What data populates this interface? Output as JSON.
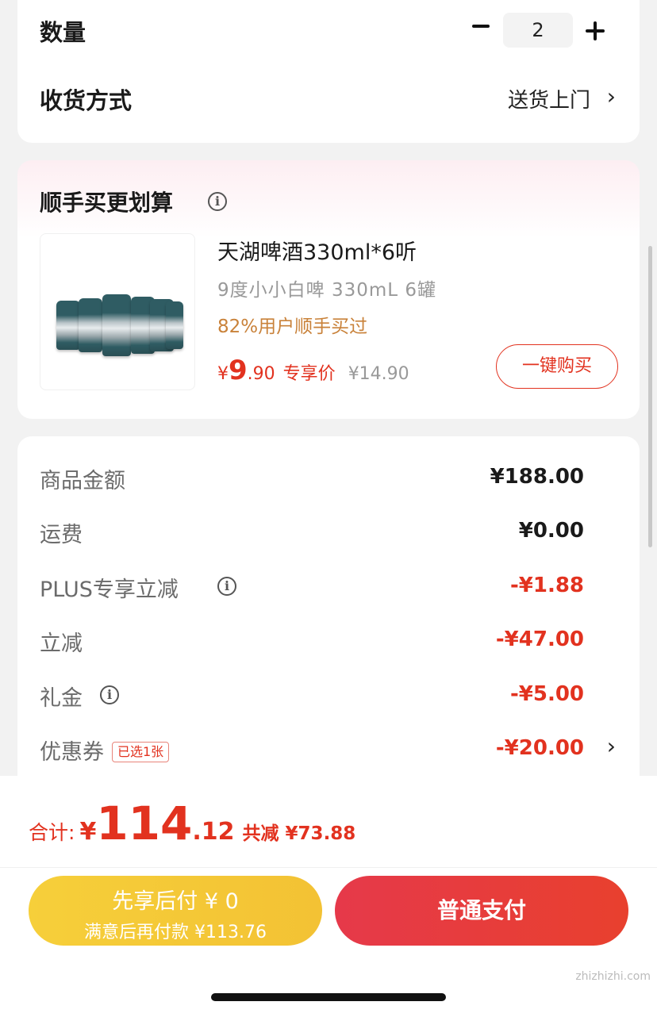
{
  "quantity_card": {
    "quantity_label": "数量",
    "quantity_value": "2",
    "delivery_label": "收货方式",
    "delivery_value": "送货上门"
  },
  "addon_card": {
    "title": "顺手买更划算",
    "product": {
      "name": "天湖啤酒330ml*6听",
      "subtitle": "9度小小白啤 330mL 6罐",
      "bought_text": "82%用户顺手买过",
      "price_currency": "¥",
      "price_int": "9",
      "price_dec": ".90",
      "price_tag": "专享价",
      "original_price": "¥14.90",
      "buy_label": "一键购买"
    }
  },
  "summary": {
    "rows": [
      {
        "label": "商品金额",
        "value": "¥188.00"
      },
      {
        "label": "运费",
        "value": "¥0.00"
      },
      {
        "label": "PLUS专享立减",
        "value": "-¥1.88"
      },
      {
        "label": "立减",
        "value": "-¥47.00"
      },
      {
        "label": "礼金",
        "value": "-¥5.00"
      },
      {
        "label": "优惠券",
        "value": "-¥20.00",
        "badge": "已选1张"
      }
    ]
  },
  "bottom": {
    "total_label": "合计:",
    "total_currency": "¥",
    "total_int": "114",
    "total_dec": ".12",
    "total_saved": "共减 ¥73.88",
    "later_pay_line1": "先享后付 ¥ 0",
    "later_pay_line2": "满意后再付款 ¥113.76",
    "pay_label": "普通支付",
    "watermark": "zhizhizhi.com"
  },
  "colors": {
    "accent_red": "#e2321f",
    "gold_text": "#c9823a",
    "later_btn_yellow": "#f3c234",
    "pay_btn_red": "#e6394a"
  }
}
